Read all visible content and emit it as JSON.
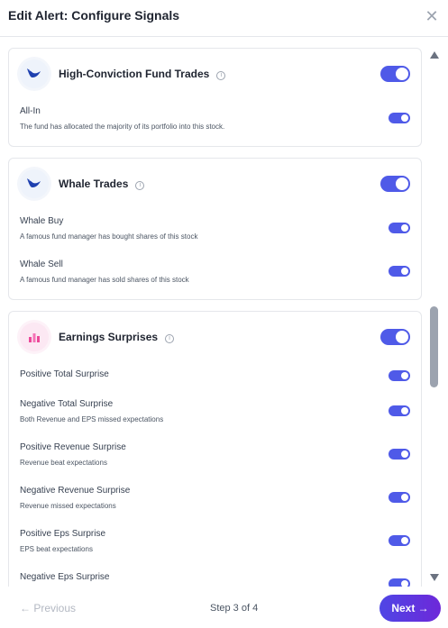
{
  "header": {
    "title": "Edit Alert: Configure Signals",
    "close_icon": "close-icon"
  },
  "cards": [
    {
      "title": "High-Conviction Fund Trades",
      "icon": "whale-icon",
      "enabled": true,
      "rows": [
        {
          "label": "All-In",
          "desc": "The fund has allocated the majority of its portfolio into this stock.",
          "enabled": true
        }
      ]
    },
    {
      "title": "Whale Trades",
      "icon": "whale-icon",
      "enabled": true,
      "rows": [
        {
          "label": "Whale Buy",
          "desc": "A famous fund manager has bought shares of this stock",
          "enabled": true
        },
        {
          "label": "Whale Sell",
          "desc": "A famous fund manager has sold shares of this stock",
          "enabled": true
        }
      ]
    },
    {
      "title": "Earnings Surprises",
      "icon": "bar-chart-icon",
      "enabled": true,
      "rows": [
        {
          "label": "Positive Total Surprise",
          "desc": "",
          "enabled": true
        },
        {
          "label": "Negative Total Surprise",
          "desc": "Both Revenue and EPS missed expectations",
          "enabled": true
        },
        {
          "label": "Positive Revenue Surprise",
          "desc": "Revenue beat expectations",
          "enabled": true
        },
        {
          "label": "Negative Revenue Surprise",
          "desc": "Revenue missed expectations",
          "enabled": true
        },
        {
          "label": "Positive Eps Surprise",
          "desc": "EPS beat expectations",
          "enabled": true
        },
        {
          "label": "Negative Eps Surprise",
          "desc": "",
          "enabled": true
        }
      ]
    }
  ],
  "footer": {
    "previous_label": "← Previous",
    "step_label": "Step 3 of 4",
    "next_label": "Next →"
  },
  "colors": {
    "accent": "#4f5ae8",
    "next_gradient_start": "#4f46e5",
    "next_gradient_end": "#6d28d9"
  }
}
